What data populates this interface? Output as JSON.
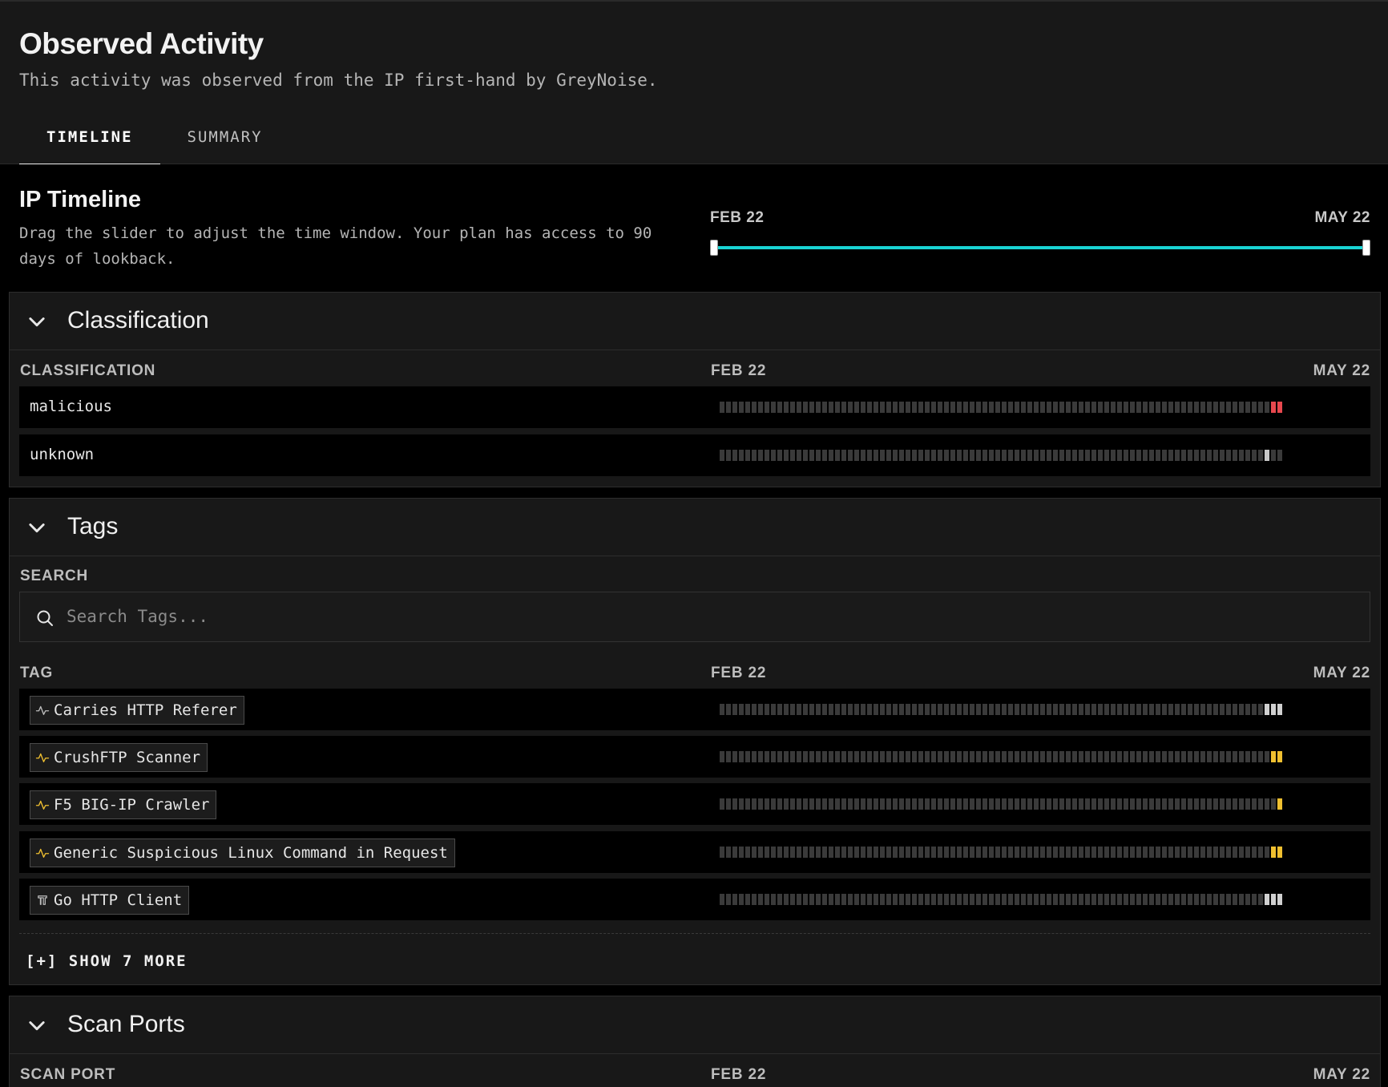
{
  "header": {
    "title": "Observed Activity",
    "subtitle": "This activity was observed from the IP first-hand by GreyNoise.",
    "tabs": [
      {
        "label": "TIMELINE",
        "active": true
      },
      {
        "label": "SUMMARY",
        "active": false
      }
    ]
  },
  "ip_timeline": {
    "title": "IP Timeline",
    "description": "Drag the slider to adjust the time window. Your plan has access to 90 days of lookback.",
    "start_date": "FEB 22",
    "end_date": "MAY 22",
    "range_start_fraction": 0.0,
    "range_end_fraction": 1.0,
    "accent_color": "#19d3d3"
  },
  "classification": {
    "title": "Classification",
    "column_label": "CLASSIFICATION",
    "start_date": "FEB 22",
    "end_date": "MAY 22",
    "rows": [
      {
        "label": "malicious",
        "active_days": [
          86,
          87
        ],
        "color": "#e8484e"
      },
      {
        "label": "unknown",
        "active_days": [
          85
        ],
        "color": "#c8c8c8"
      }
    ]
  },
  "tags": {
    "title": "Tags",
    "search_label": "SEARCH",
    "search_placeholder": "Search Tags...",
    "column_label": "TAG",
    "start_date": "FEB 22",
    "end_date": "MAY 22",
    "rows": [
      {
        "label": "Carries HTTP Referer",
        "icon": "activity-icon",
        "icon_color": "#bdbdbd",
        "active_days": [
          85,
          86,
          87
        ],
        "color": "#d0d0d0"
      },
      {
        "label": "CrushFTP Scanner",
        "icon": "activity-icon",
        "icon_color": "#f0c030",
        "active_days": [
          86,
          87
        ],
        "color": "#f0c030"
      },
      {
        "label": "F5 BIG-IP Crawler",
        "icon": "activity-icon",
        "icon_color": "#f0c030",
        "active_days": [
          87
        ],
        "color": "#f0c030"
      },
      {
        "label": "Generic Suspicious Linux Command in Request",
        "icon": "activity-icon",
        "icon_color": "#f0c030",
        "active_days": [
          86,
          87
        ],
        "color": "#f0c030"
      },
      {
        "label": "Go HTTP Client",
        "icon": "tool-icon",
        "icon_color": "#bdbdbd",
        "active_days": [
          85,
          86,
          87
        ],
        "color": "#d0d0d0"
      }
    ],
    "show_more_label": "[+] SHOW 7 MORE"
  },
  "scan_ports": {
    "title": "Scan Ports",
    "column_label": "SCAN PORT",
    "start_date": "FEB 22",
    "end_date": "MAY 22"
  }
}
